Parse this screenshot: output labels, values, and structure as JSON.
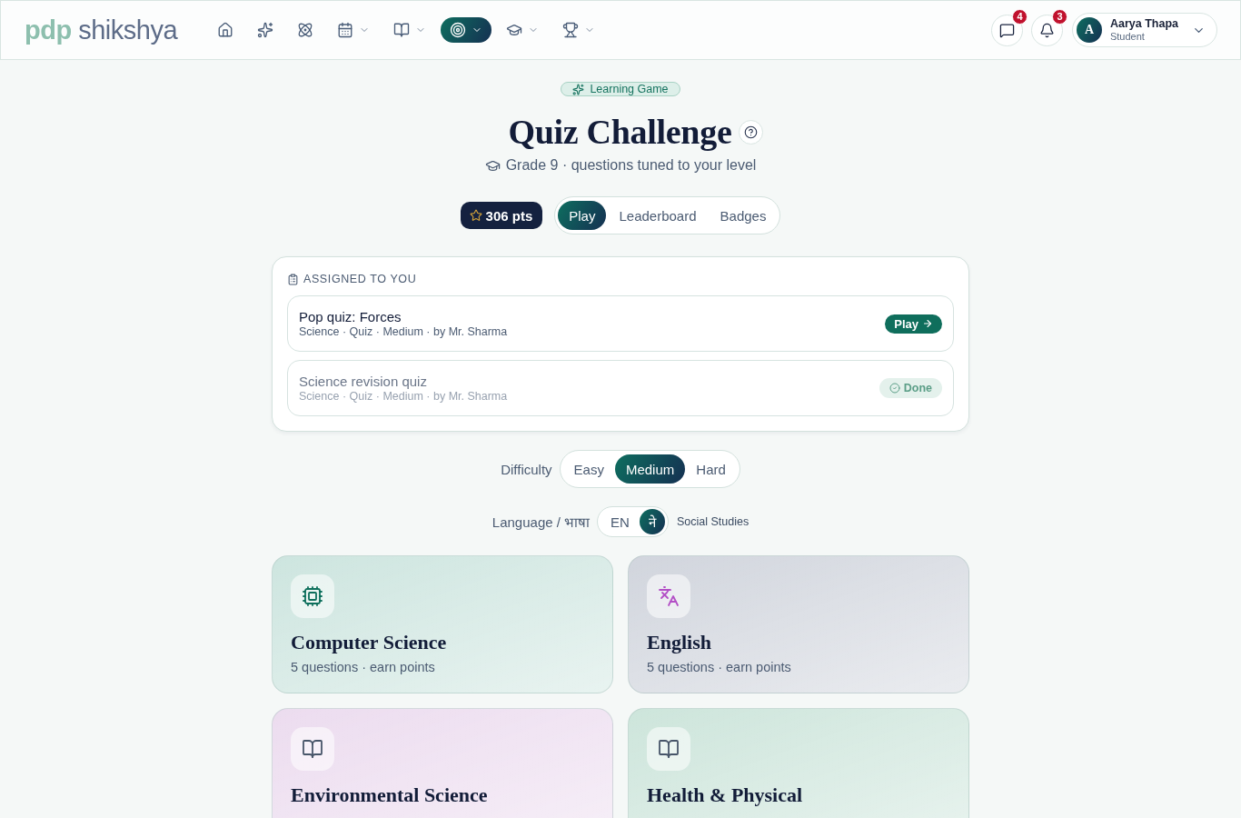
{
  "header": {
    "logo": {
      "primary": "pdp",
      "secondary": "shikshya"
    },
    "nav": [
      {
        "selected": false,
        "dropdown": false
      },
      {
        "selected": false,
        "dropdown": false
      },
      {
        "selected": false,
        "dropdown": false
      },
      {
        "selected": false,
        "dropdown": true
      },
      {
        "selected": false,
        "dropdown": true
      },
      {
        "selected": true,
        "dropdown": true
      },
      {
        "selected": false,
        "dropdown": true
      },
      {
        "selected": false,
        "dropdown": true
      }
    ],
    "messages": {
      "count": "4"
    },
    "notifications": {
      "count": "3"
    },
    "user": {
      "initial": "A",
      "name": "Aarya Thapa",
      "role": "Student"
    }
  },
  "hero": {
    "tag": "Learning Game",
    "title": "Quiz Challenge",
    "subtitle": "Grade 9 · questions tuned to your level"
  },
  "points": "306 pts",
  "tabs": [
    {
      "label": "Play",
      "selected": true
    },
    {
      "label": "Leaderboard",
      "selected": false
    },
    {
      "label": "Badges",
      "selected": false
    }
  ],
  "assigned": {
    "heading": "ASSIGNED TO YOU",
    "items": [
      {
        "title": "Pop quiz: Forces",
        "meta": "Science · Quiz · Medium · by Mr. Sharma",
        "done": false,
        "action": "Play"
      },
      {
        "title": "Science revision quiz",
        "meta": "Science · Quiz · Medium · by Mr. Sharma",
        "done": true,
        "action": "Done"
      }
    ]
  },
  "difficulty": {
    "label": "Difficulty",
    "options": [
      {
        "label": "Easy",
        "selected": false
      },
      {
        "label": "Medium",
        "selected": true
      },
      {
        "label": "Hard",
        "selected": false
      }
    ]
  },
  "language": {
    "label": "Language / भाषा",
    "options": [
      {
        "label": "EN",
        "selected": false
      },
      {
        "label": "ने",
        "selected": true
      }
    ],
    "subject": "Social Studies"
  },
  "subjects": [
    {
      "name": "Computer Science",
      "info": "5 questions · earn points",
      "kind": "chip",
      "color": "#cde5df"
    },
    {
      "name": "English",
      "info": "5 questions · earn points",
      "kind": "translate",
      "color": "#d1d5dd"
    },
    {
      "name": "Environmental Science",
      "kind": "book",
      "color": "#ecdcef"
    },
    {
      "name": "Health & Physical",
      "kind": "book",
      "color": "#cde5db"
    }
  ]
}
